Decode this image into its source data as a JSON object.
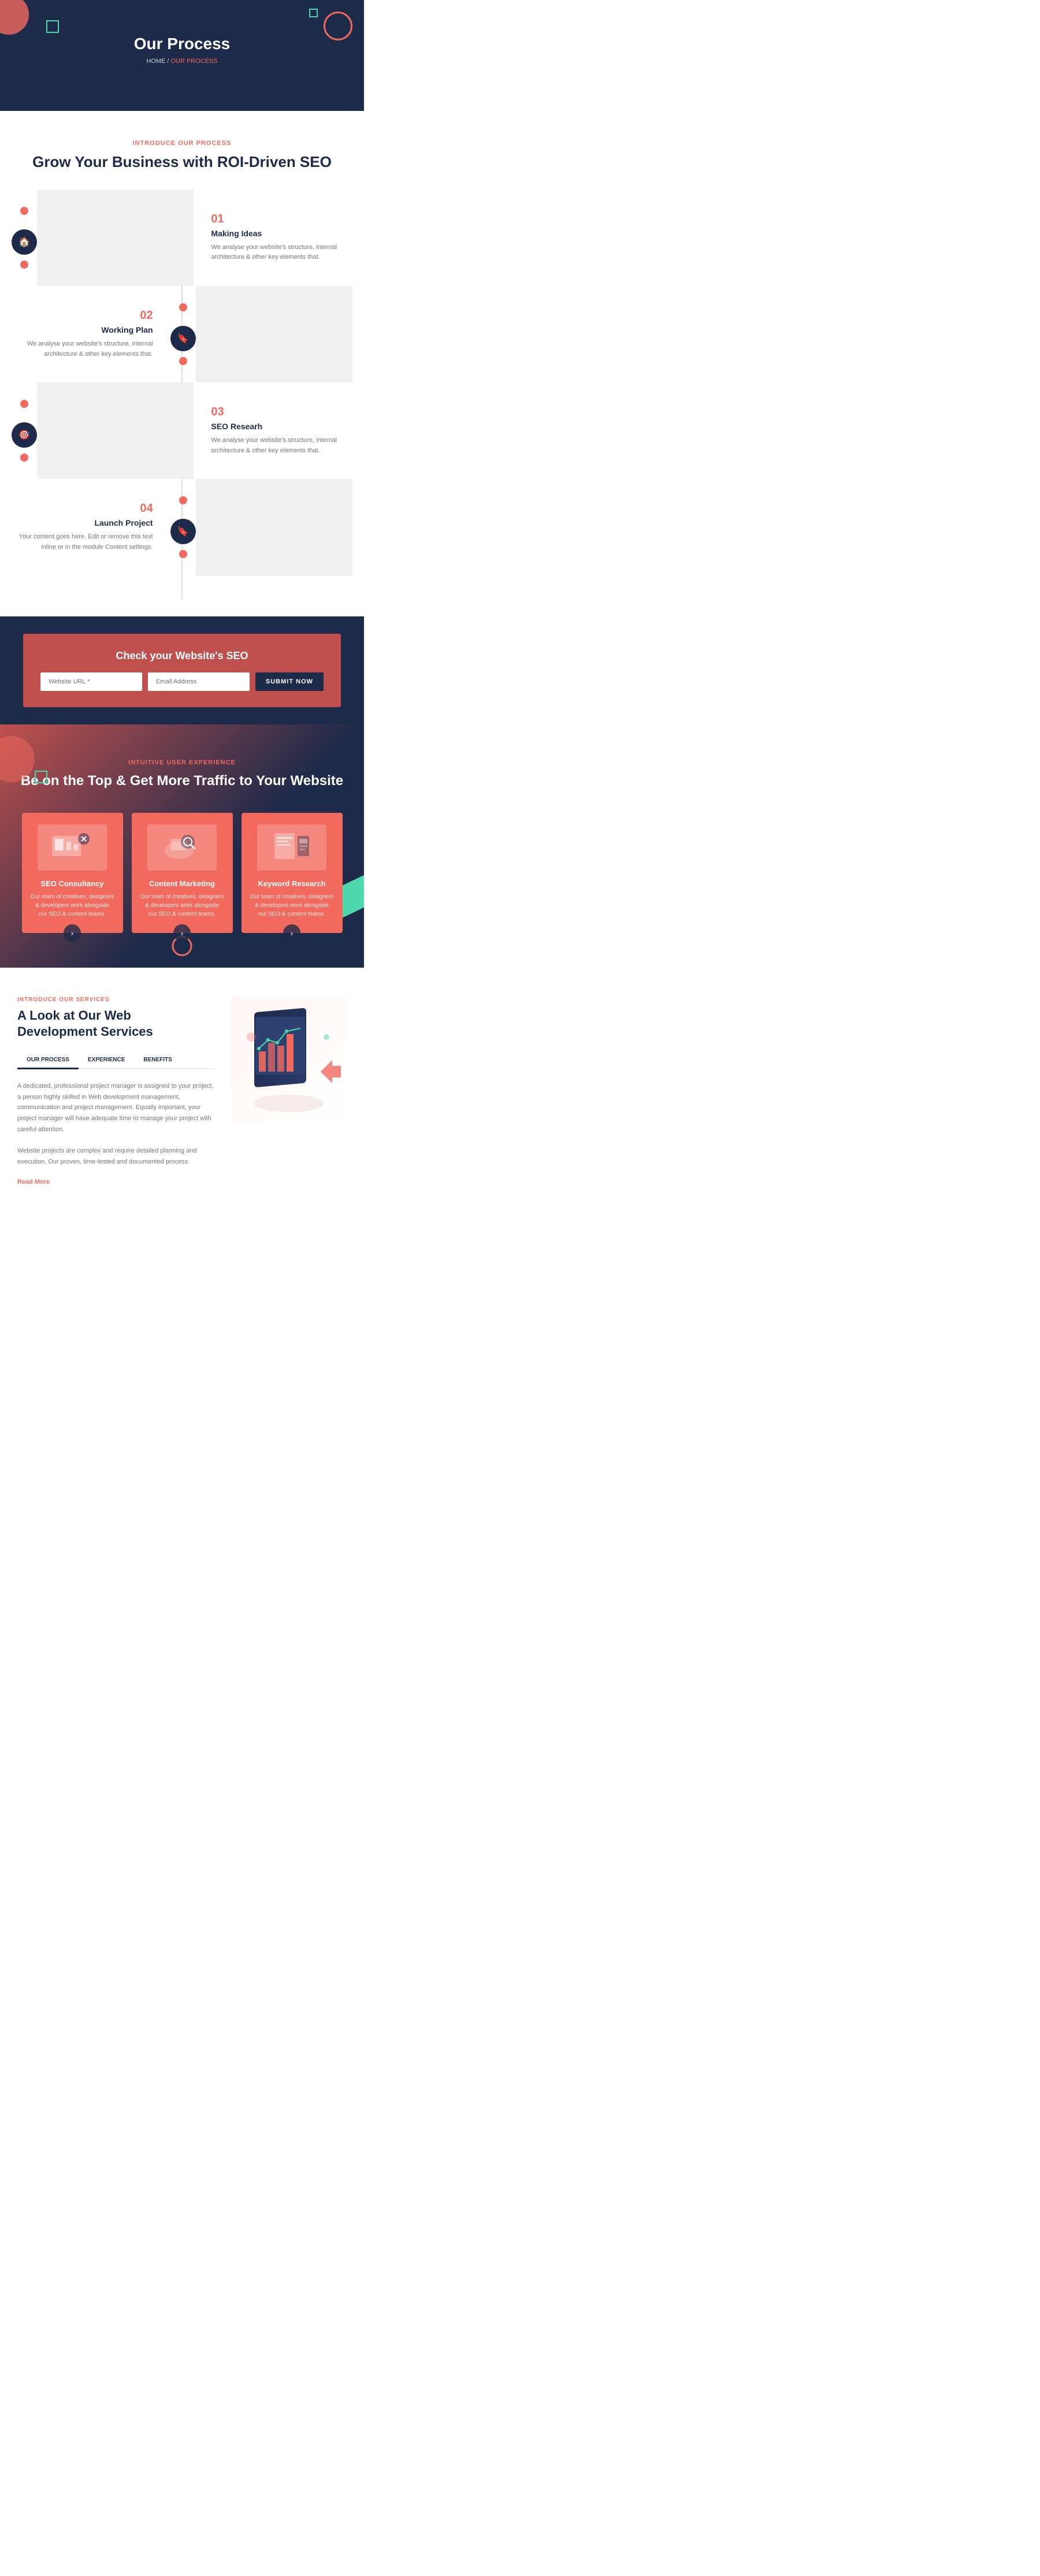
{
  "hero": {
    "title": "Our Process",
    "breadcrumb_home": "HOME",
    "breadcrumb_current": "OUR PROCESS"
  },
  "process": {
    "tag": "INTRODUCE OUR PROCESS",
    "title": "Grow Your Business with ROI-Driven SEO",
    "steps": [
      {
        "number": "01",
        "title": "Making Ideas",
        "desc": "We analyse your website's structure, internal architecture & other key elements that.",
        "icon": "🏠",
        "side": "right"
      },
      {
        "number": "02",
        "title": "Working Plan",
        "desc": "We analyse your website's structure, internal architecture & other key elements that.",
        "icon": "🔖",
        "side": "left"
      },
      {
        "number": "03",
        "title": "SEO Researh",
        "desc": "We analyse your website's structure, internal architecture & other key elements that.",
        "icon": "🎯",
        "side": "right"
      },
      {
        "number": "04",
        "title": "Launch Project",
        "desc": "Your content goes here. Edit or remove this text inline or in the module Content settings.",
        "icon": "🔖",
        "side": "left"
      }
    ]
  },
  "seo_check": {
    "title": "Check your Website's SEO",
    "url_placeholder": "Website URL *",
    "email_placeholder": "Email Address",
    "button_label": "SUBMIT NOW"
  },
  "features": {
    "tag": "Intuitive User Experience",
    "title": "Be on the Top & Get More Traffic to Your Website",
    "cards": [
      {
        "title": "SEO Consultancy",
        "desc": "Our team of creatives, designers & developers work alongside our SEO & content teams."
      },
      {
        "title": "Content Marketing",
        "desc": "Our team of creatives, designers & developers work alongside our SEO & content teams."
      },
      {
        "title": "Keyword Research",
        "desc": "Our team of creatives, designers & developers work alongside our SEO & content teams."
      }
    ]
  },
  "services": {
    "tag": "INTRODUCE OUR SERVICES",
    "title": "A Look at Our Web Development Services",
    "tabs": [
      "OUR PROCESS",
      "EXPERIENCE",
      "BENEFITS"
    ],
    "active_tab": 0,
    "content": "A dedicated, professional project manager is assigned to your project, a person highly skilled in Web development management, communication and project management. Equally important, your project manager will have adequate time to manage your project with careful attention.\n\nWebsite projects are complex and require detailed planning and execution. Our proven, time-tested and documented process.",
    "read_more": "Read More"
  }
}
